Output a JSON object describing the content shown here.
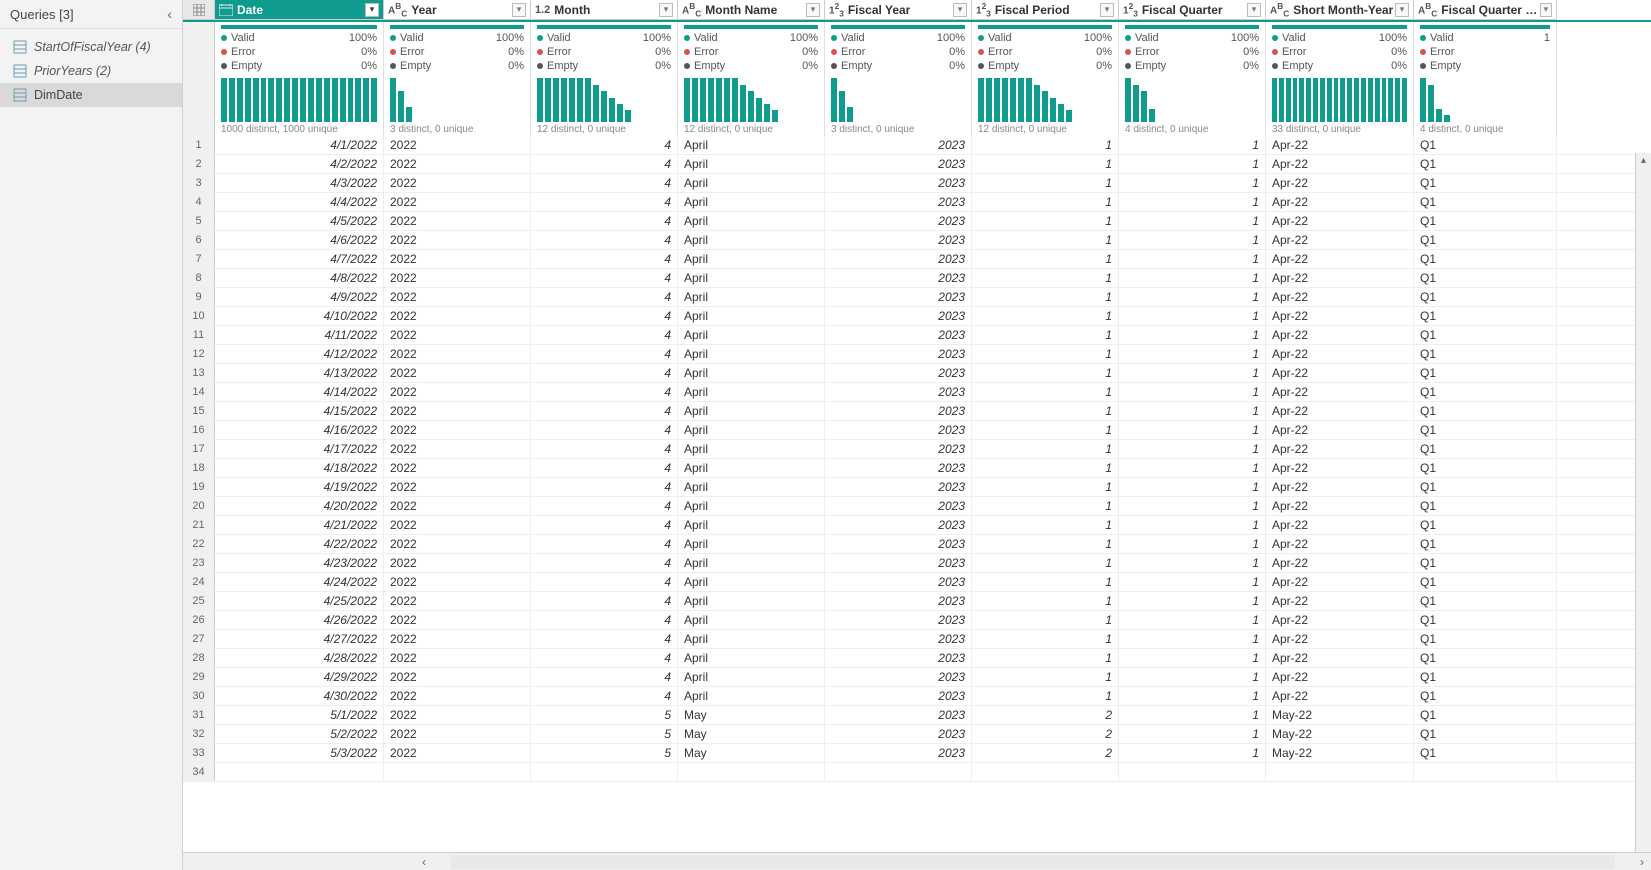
{
  "sidebar": {
    "title": "Queries [3]",
    "items": [
      {
        "label": "StartOfFiscalYear (4)",
        "italic": true
      },
      {
        "label": "PriorYears (2)",
        "italic": true
      },
      {
        "label": "DimDate",
        "italic": false,
        "selected": true
      }
    ]
  },
  "columns": [
    {
      "name": "Date",
      "type": "date",
      "w": "col-w-0",
      "selected": true,
      "distLabel": "1000 distinct, 1000 unique",
      "bars": [
        1,
        1,
        1,
        1,
        1,
        1,
        1,
        1,
        1,
        1,
        1,
        1,
        1,
        1,
        1,
        1,
        1,
        1,
        1,
        1
      ]
    },
    {
      "name": "Year",
      "type": "abc",
      "w": "col-w-1",
      "distLabel": "3 distinct, 0 unique",
      "bars": [
        1,
        0.7,
        0.35
      ]
    },
    {
      "name": "Month",
      "type": "dec",
      "w": "col-w-2",
      "distLabel": "12 distinct, 0 unique",
      "bars": [
        1,
        1,
        1,
        1,
        1,
        1,
        1,
        0.85,
        0.7,
        0.55,
        0.4,
        0.28
      ]
    },
    {
      "name": "Month Name",
      "type": "abc",
      "w": "col-w-3",
      "distLabel": "12 distinct, 0 unique",
      "bars": [
        1,
        1,
        1,
        1,
        1,
        1,
        1,
        0.85,
        0.7,
        0.55,
        0.4,
        0.28
      ]
    },
    {
      "name": "Fiscal Year",
      "type": "int",
      "w": "col-w-4",
      "distLabel": "3 distinct, 0 unique",
      "bars": [
        1,
        0.7,
        0.35
      ]
    },
    {
      "name": "Fiscal Period",
      "type": "int",
      "w": "col-w-5",
      "distLabel": "12 distinct, 0 unique",
      "bars": [
        1,
        1,
        1,
        1,
        1,
        1,
        1,
        0.85,
        0.7,
        0.55,
        0.4,
        0.28
      ]
    },
    {
      "name": "Fiscal Quarter",
      "type": "int",
      "w": "col-w-6",
      "distLabel": "4 distinct, 0 unique",
      "bars": [
        1,
        0.85,
        0.7,
        0.3
      ]
    },
    {
      "name": "Short Month-Year",
      "type": "abc",
      "w": "col-w-7",
      "distLabel": "33 distinct, 0 unique",
      "bars": [
        1,
        1,
        1,
        1,
        1,
        1,
        1,
        1,
        1,
        1,
        1,
        1,
        1,
        1,
        1,
        1,
        1,
        1,
        1,
        1
      ]
    },
    {
      "name": "Fiscal Quarter Name",
      "type": "abc",
      "w": "col-w-8",
      "distLabel": "4 distinct, 0 unique",
      "bars": [
        1,
        0.85,
        0.3,
        0.15
      ]
    }
  ],
  "quality": {
    "valid": {
      "label": "Valid",
      "pct": "100%",
      "color": "#0f9b8e"
    },
    "error": {
      "label": "Error",
      "pct": "0%",
      "color": "#d9534f"
    },
    "empty": {
      "label": "Empty",
      "pct": "0%",
      "color": "#555"
    },
    "short": {
      "valid": "1"
    }
  },
  "rows": [
    {
      "n": 1,
      "Date": "4/1/2022",
      "Year": "2022",
      "Month": "4",
      "MonthName": "April",
      "FY": "2023",
      "FP": "1",
      "FQ": "1",
      "SMY": "Apr-22",
      "FQN": "Q1"
    },
    {
      "n": 2,
      "Date": "4/2/2022",
      "Year": "2022",
      "Month": "4",
      "MonthName": "April",
      "FY": "2023",
      "FP": "1",
      "FQ": "1",
      "SMY": "Apr-22",
      "FQN": "Q1"
    },
    {
      "n": 3,
      "Date": "4/3/2022",
      "Year": "2022",
      "Month": "4",
      "MonthName": "April",
      "FY": "2023",
      "FP": "1",
      "FQ": "1",
      "SMY": "Apr-22",
      "FQN": "Q1"
    },
    {
      "n": 4,
      "Date": "4/4/2022",
      "Year": "2022",
      "Month": "4",
      "MonthName": "April",
      "FY": "2023",
      "FP": "1",
      "FQ": "1",
      "SMY": "Apr-22",
      "FQN": "Q1"
    },
    {
      "n": 5,
      "Date": "4/5/2022",
      "Year": "2022",
      "Month": "4",
      "MonthName": "April",
      "FY": "2023",
      "FP": "1",
      "FQ": "1",
      "SMY": "Apr-22",
      "FQN": "Q1"
    },
    {
      "n": 6,
      "Date": "4/6/2022",
      "Year": "2022",
      "Month": "4",
      "MonthName": "April",
      "FY": "2023",
      "FP": "1",
      "FQ": "1",
      "SMY": "Apr-22",
      "FQN": "Q1"
    },
    {
      "n": 7,
      "Date": "4/7/2022",
      "Year": "2022",
      "Month": "4",
      "MonthName": "April",
      "FY": "2023",
      "FP": "1",
      "FQ": "1",
      "SMY": "Apr-22",
      "FQN": "Q1"
    },
    {
      "n": 8,
      "Date": "4/8/2022",
      "Year": "2022",
      "Month": "4",
      "MonthName": "April",
      "FY": "2023",
      "FP": "1",
      "FQ": "1",
      "SMY": "Apr-22",
      "FQN": "Q1"
    },
    {
      "n": 9,
      "Date": "4/9/2022",
      "Year": "2022",
      "Month": "4",
      "MonthName": "April",
      "FY": "2023",
      "FP": "1",
      "FQ": "1",
      "SMY": "Apr-22",
      "FQN": "Q1"
    },
    {
      "n": 10,
      "Date": "4/10/2022",
      "Year": "2022",
      "Month": "4",
      "MonthName": "April",
      "FY": "2023",
      "FP": "1",
      "FQ": "1",
      "SMY": "Apr-22",
      "FQN": "Q1"
    },
    {
      "n": 11,
      "Date": "4/11/2022",
      "Year": "2022",
      "Month": "4",
      "MonthName": "April",
      "FY": "2023",
      "FP": "1",
      "FQ": "1",
      "SMY": "Apr-22",
      "FQN": "Q1"
    },
    {
      "n": 12,
      "Date": "4/12/2022",
      "Year": "2022",
      "Month": "4",
      "MonthName": "April",
      "FY": "2023",
      "FP": "1",
      "FQ": "1",
      "SMY": "Apr-22",
      "FQN": "Q1"
    },
    {
      "n": 13,
      "Date": "4/13/2022",
      "Year": "2022",
      "Month": "4",
      "MonthName": "April",
      "FY": "2023",
      "FP": "1",
      "FQ": "1",
      "SMY": "Apr-22",
      "FQN": "Q1"
    },
    {
      "n": 14,
      "Date": "4/14/2022",
      "Year": "2022",
      "Month": "4",
      "MonthName": "April",
      "FY": "2023",
      "FP": "1",
      "FQ": "1",
      "SMY": "Apr-22",
      "FQN": "Q1"
    },
    {
      "n": 15,
      "Date": "4/15/2022",
      "Year": "2022",
      "Month": "4",
      "MonthName": "April",
      "FY": "2023",
      "FP": "1",
      "FQ": "1",
      "SMY": "Apr-22",
      "FQN": "Q1"
    },
    {
      "n": 16,
      "Date": "4/16/2022",
      "Year": "2022",
      "Month": "4",
      "MonthName": "April",
      "FY": "2023",
      "FP": "1",
      "FQ": "1",
      "SMY": "Apr-22",
      "FQN": "Q1"
    },
    {
      "n": 17,
      "Date": "4/17/2022",
      "Year": "2022",
      "Month": "4",
      "MonthName": "April",
      "FY": "2023",
      "FP": "1",
      "FQ": "1",
      "SMY": "Apr-22",
      "FQN": "Q1"
    },
    {
      "n": 18,
      "Date": "4/18/2022",
      "Year": "2022",
      "Month": "4",
      "MonthName": "April",
      "FY": "2023",
      "FP": "1",
      "FQ": "1",
      "SMY": "Apr-22",
      "FQN": "Q1"
    },
    {
      "n": 19,
      "Date": "4/19/2022",
      "Year": "2022",
      "Month": "4",
      "MonthName": "April",
      "FY": "2023",
      "FP": "1",
      "FQ": "1",
      "SMY": "Apr-22",
      "FQN": "Q1"
    },
    {
      "n": 20,
      "Date": "4/20/2022",
      "Year": "2022",
      "Month": "4",
      "MonthName": "April",
      "FY": "2023",
      "FP": "1",
      "FQ": "1",
      "SMY": "Apr-22",
      "FQN": "Q1"
    },
    {
      "n": 21,
      "Date": "4/21/2022",
      "Year": "2022",
      "Month": "4",
      "MonthName": "April",
      "FY": "2023",
      "FP": "1",
      "FQ": "1",
      "SMY": "Apr-22",
      "FQN": "Q1"
    },
    {
      "n": 22,
      "Date": "4/22/2022",
      "Year": "2022",
      "Month": "4",
      "MonthName": "April",
      "FY": "2023",
      "FP": "1",
      "FQ": "1",
      "SMY": "Apr-22",
      "FQN": "Q1"
    },
    {
      "n": 23,
      "Date": "4/23/2022",
      "Year": "2022",
      "Month": "4",
      "MonthName": "April",
      "FY": "2023",
      "FP": "1",
      "FQ": "1",
      "SMY": "Apr-22",
      "FQN": "Q1"
    },
    {
      "n": 24,
      "Date": "4/24/2022",
      "Year": "2022",
      "Month": "4",
      "MonthName": "April",
      "FY": "2023",
      "FP": "1",
      "FQ": "1",
      "SMY": "Apr-22",
      "FQN": "Q1"
    },
    {
      "n": 25,
      "Date": "4/25/2022",
      "Year": "2022",
      "Month": "4",
      "MonthName": "April",
      "FY": "2023",
      "FP": "1",
      "FQ": "1",
      "SMY": "Apr-22",
      "FQN": "Q1"
    },
    {
      "n": 26,
      "Date": "4/26/2022",
      "Year": "2022",
      "Month": "4",
      "MonthName": "April",
      "FY": "2023",
      "FP": "1",
      "FQ": "1",
      "SMY": "Apr-22",
      "FQN": "Q1"
    },
    {
      "n": 27,
      "Date": "4/27/2022",
      "Year": "2022",
      "Month": "4",
      "MonthName": "April",
      "FY": "2023",
      "FP": "1",
      "FQ": "1",
      "SMY": "Apr-22",
      "FQN": "Q1"
    },
    {
      "n": 28,
      "Date": "4/28/2022",
      "Year": "2022",
      "Month": "4",
      "MonthName": "April",
      "FY": "2023",
      "FP": "1",
      "FQ": "1",
      "SMY": "Apr-22",
      "FQN": "Q1"
    },
    {
      "n": 29,
      "Date": "4/29/2022",
      "Year": "2022",
      "Month": "4",
      "MonthName": "April",
      "FY": "2023",
      "FP": "1",
      "FQ": "1",
      "SMY": "Apr-22",
      "FQN": "Q1"
    },
    {
      "n": 30,
      "Date": "4/30/2022",
      "Year": "2022",
      "Month": "4",
      "MonthName": "April",
      "FY": "2023",
      "FP": "1",
      "FQ": "1",
      "SMY": "Apr-22",
      "FQN": "Q1"
    },
    {
      "n": 31,
      "Date": "5/1/2022",
      "Year": "2022",
      "Month": "5",
      "MonthName": "May",
      "FY": "2023",
      "FP": "2",
      "FQ": "1",
      "SMY": "May-22",
      "FQN": "Q1"
    },
    {
      "n": 32,
      "Date": "5/2/2022",
      "Year": "2022",
      "Month": "5",
      "MonthName": "May",
      "FY": "2023",
      "FP": "2",
      "FQ": "1",
      "SMY": "May-22",
      "FQN": "Q1"
    },
    {
      "n": 33,
      "Date": "5/3/2022",
      "Year": "2022",
      "Month": "5",
      "MonthName": "May",
      "FY": "2023",
      "FP": "2",
      "FQ": "1",
      "SMY": "May-22",
      "FQN": "Q1"
    },
    {
      "n": 34,
      "Date": "",
      "Year": "",
      "Month": "",
      "MonthName": "",
      "FY": "",
      "FP": "",
      "FQ": "",
      "SMY": "",
      "FQN": ""
    }
  ]
}
